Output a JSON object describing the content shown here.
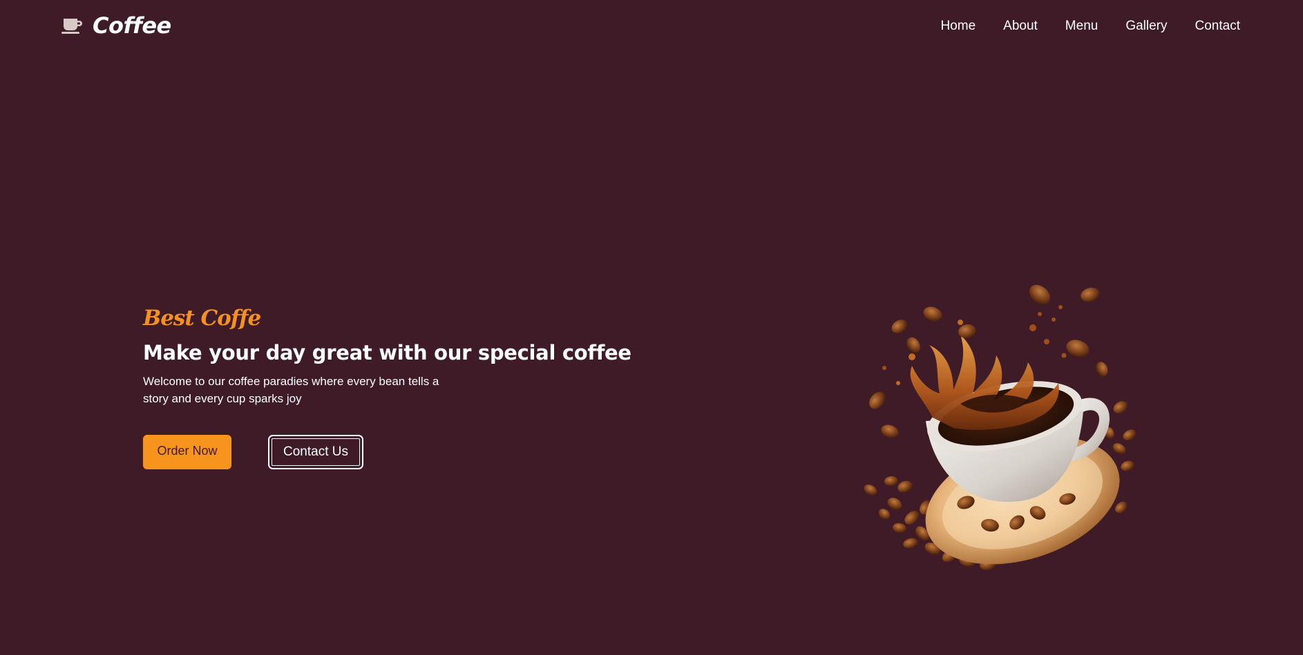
{
  "header": {
    "logo_text": "Coffee",
    "logo_icon": "coffee-cup-icon",
    "nav": [
      {
        "label": "Home"
      },
      {
        "label": "About"
      },
      {
        "label": "Menu"
      },
      {
        "label": "Gallery"
      },
      {
        "label": "Contact"
      }
    ]
  },
  "hero": {
    "tagline": "Best Coffe",
    "headline": "Make your day great with our special coffee",
    "description": "Welcome to our coffee paradies where every bean tells a story and every cup sparks joy",
    "order_button": "Order Now",
    "contact_button": "Contact Us",
    "image_subject": "coffee-cup-splash-illustration"
  },
  "colors": {
    "background": "#3f1b27",
    "accent": "#f7941d",
    "text": "#ffffff"
  }
}
